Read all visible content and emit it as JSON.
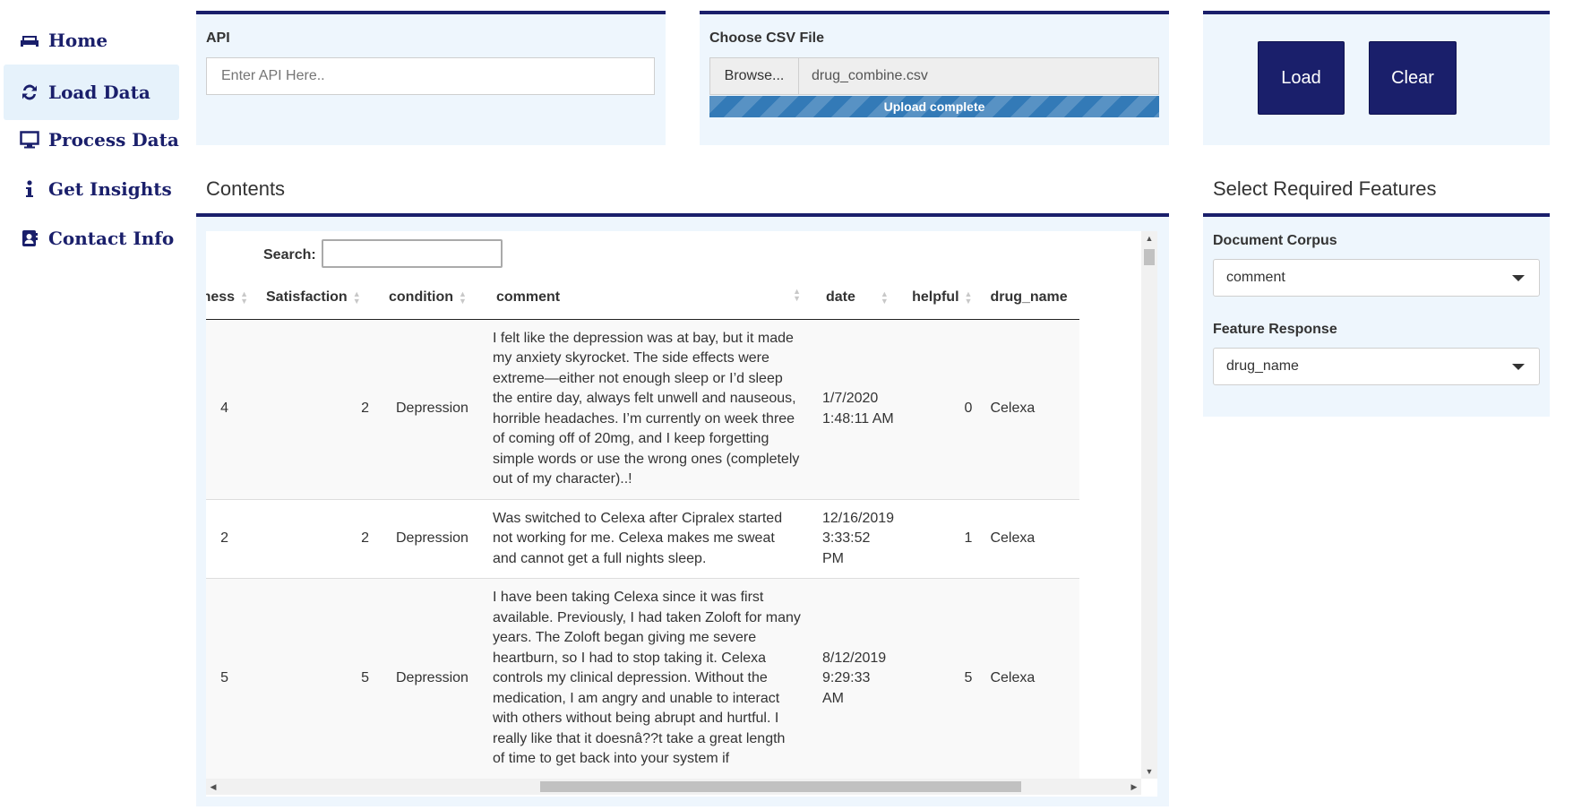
{
  "sidebar": {
    "items": [
      {
        "label": "Home",
        "icon": "sofa-icon",
        "active": false
      },
      {
        "label": "Load Data",
        "icon": "refresh-icon",
        "active": true
      },
      {
        "label": "Process Data",
        "icon": "desktop-icon",
        "active": false
      },
      {
        "label": "Get Insights",
        "icon": "info-icon",
        "active": false
      },
      {
        "label": "Contact Info",
        "icon": "address-book-icon",
        "active": false
      }
    ]
  },
  "api": {
    "label": "API",
    "placeholder": "Enter API Here.."
  },
  "upload": {
    "label": "Choose CSV File",
    "browse_label": "Browse...",
    "file_name": "drug_combine.csv",
    "progress_text": "Upload complete",
    "progress_percent": 100
  },
  "actions": {
    "load_label": "Load",
    "clear_label": "Clear"
  },
  "contents": {
    "title": "Contents",
    "search_label": "Search:",
    "search_value": "",
    "columns": [
      "ness",
      "Satisfaction",
      "condition",
      "comment",
      "date",
      "helpful",
      "drug_name"
    ],
    "rows": [
      {
        "ness": "4",
        "satisfaction": "2",
        "condition": "Depression",
        "comment": "I felt like the depression was at bay, but it made my anxiety skyrocket. The side effects were extreme—either not enough sleep or I’d sleep the entire day, always felt unwell and nauseous, horrible headaches. I’m currently on week three of coming off of 20mg, and I keep forgetting simple words or use the wrong ones (completely out of my character)..!",
        "date": "1/7/2020 1:48:11 AM",
        "helpful": "0",
        "drug_name": "Celexa"
      },
      {
        "ness": "2",
        "satisfaction": "2",
        "condition": "Depression",
        "comment": "Was switched to Celexa after Cipralex started not working for me. Celexa makes me sweat and cannot get a full nights sleep.",
        "date": "12/16/2019 3:33:52 PM",
        "helpful": "1",
        "drug_name": "Celexa"
      },
      {
        "ness": "5",
        "satisfaction": "5",
        "condition": "Depression",
        "comment": "I have been taking Celexa since it was first available. Previously, I had taken Zoloft for many years. The Zoloft began giving me severe heartburn, so I had to stop taking it. Celexa controls my clinical depression. Without the medication, I am angry and unable to interact with others without being abrupt and hurtful. I really like that it doesnâ??t take a great length of time to get back into your system if",
        "date": "8/12/2019 9:29:33 AM",
        "helpful": "5",
        "drug_name": "Celexa"
      }
    ]
  },
  "features": {
    "title": "Select Required Features",
    "corpus_label": "Document Corpus",
    "corpus_value": "comment",
    "response_label": "Feature Response",
    "response_value": "drug_name"
  },
  "colors": {
    "accent": "#1a1f6b",
    "panel": "#eef6fd",
    "progress": "#337ab7"
  }
}
